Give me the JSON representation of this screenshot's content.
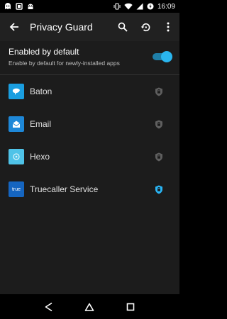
{
  "status_bar": {
    "time": "16:09",
    "left_icons": [
      "ghost-notification-icon",
      "square-notification-icon",
      "android-notification-icon"
    ],
    "right_icons": [
      "vibrate-icon",
      "wifi-icon",
      "signal-icon",
      "battery-charging-icon"
    ]
  },
  "toolbar": {
    "title": "Privacy Guard",
    "actions": [
      "search-icon",
      "history-icon",
      "more-vert-icon"
    ]
  },
  "settings": {
    "enabled_default": {
      "title": "Enabled by default",
      "subtitle": "Enable by default for newly-installed apps",
      "checked": true
    }
  },
  "apps": [
    {
      "name": "Baton",
      "icon": "baton-app-icon",
      "icon_color": "#1a9ee0",
      "guarded": false
    },
    {
      "name": "Email",
      "icon": "email-app-icon",
      "icon_color": "#1e88d8",
      "guarded": false
    },
    {
      "name": "Hexo",
      "icon": "hexo-app-icon",
      "icon_color": "#4fc3e8",
      "guarded": false
    },
    {
      "name": "Truecaller Service",
      "icon": "truecaller-app-icon",
      "icon_color": "#1565c0",
      "icon_text": "true",
      "guarded": true
    }
  ],
  "colors": {
    "accent": "#2ab6ef",
    "shield_off": "#5f5f5f",
    "shield_on": "#29b6f6",
    "toolbar_bg": "#212121",
    "content_bg": "#1c1c1c"
  },
  "nav_bar": {
    "buttons": [
      "back-nav-icon",
      "home-nav-icon",
      "recents-nav-icon"
    ]
  }
}
